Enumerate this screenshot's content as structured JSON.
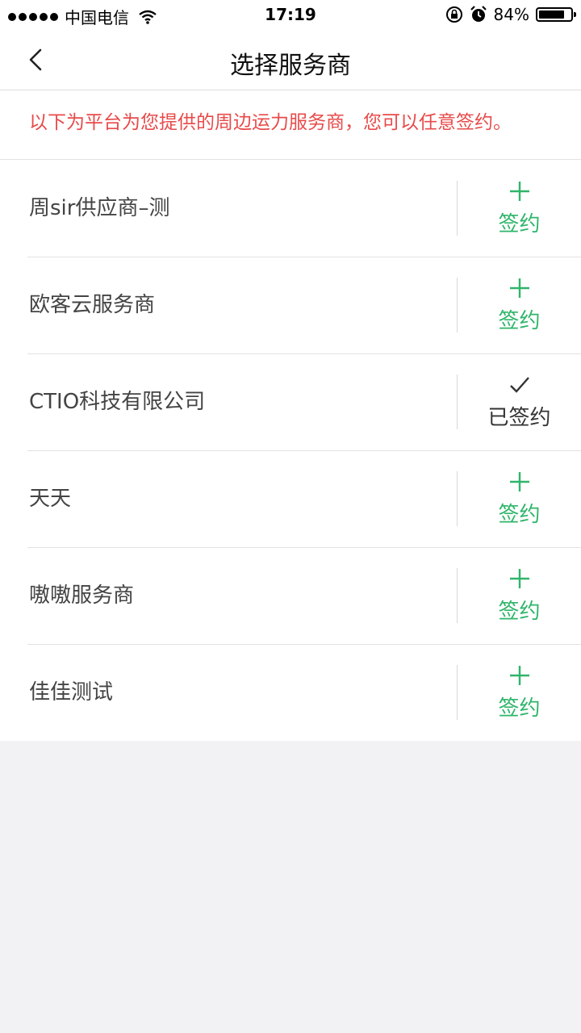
{
  "status_bar": {
    "carrier": "中国电信",
    "time": "17:19",
    "battery": "84%",
    "battery_level": 0.84,
    "icons": [
      "signal-dots-icon",
      "wifi-icon",
      "rotation-lock-icon",
      "alarm-icon",
      "battery-icon"
    ]
  },
  "nav": {
    "title": "选择服务商",
    "back_icon": "chevron-left-icon"
  },
  "notice": {
    "text": "以下为平台为您提供的周边运力服务商，您可以任意签约。",
    "color": "#e84a4a"
  },
  "colors": {
    "accent": "#2fb56a",
    "signed": "#333333"
  },
  "providers": [
    {
      "name": "周sir供应商–测",
      "status": "签约",
      "signed": false
    },
    {
      "name": "欧客云服务商",
      "status": "签约",
      "signed": false
    },
    {
      "name": "CTIO科技有限公司",
      "status": "已签约",
      "signed": true
    },
    {
      "name": "天天",
      "status": "签约",
      "signed": false
    },
    {
      "name": "嗷嗷服务商",
      "status": "签约",
      "signed": false
    },
    {
      "name": "佳佳测试",
      "status": "签约",
      "signed": false
    }
  ]
}
